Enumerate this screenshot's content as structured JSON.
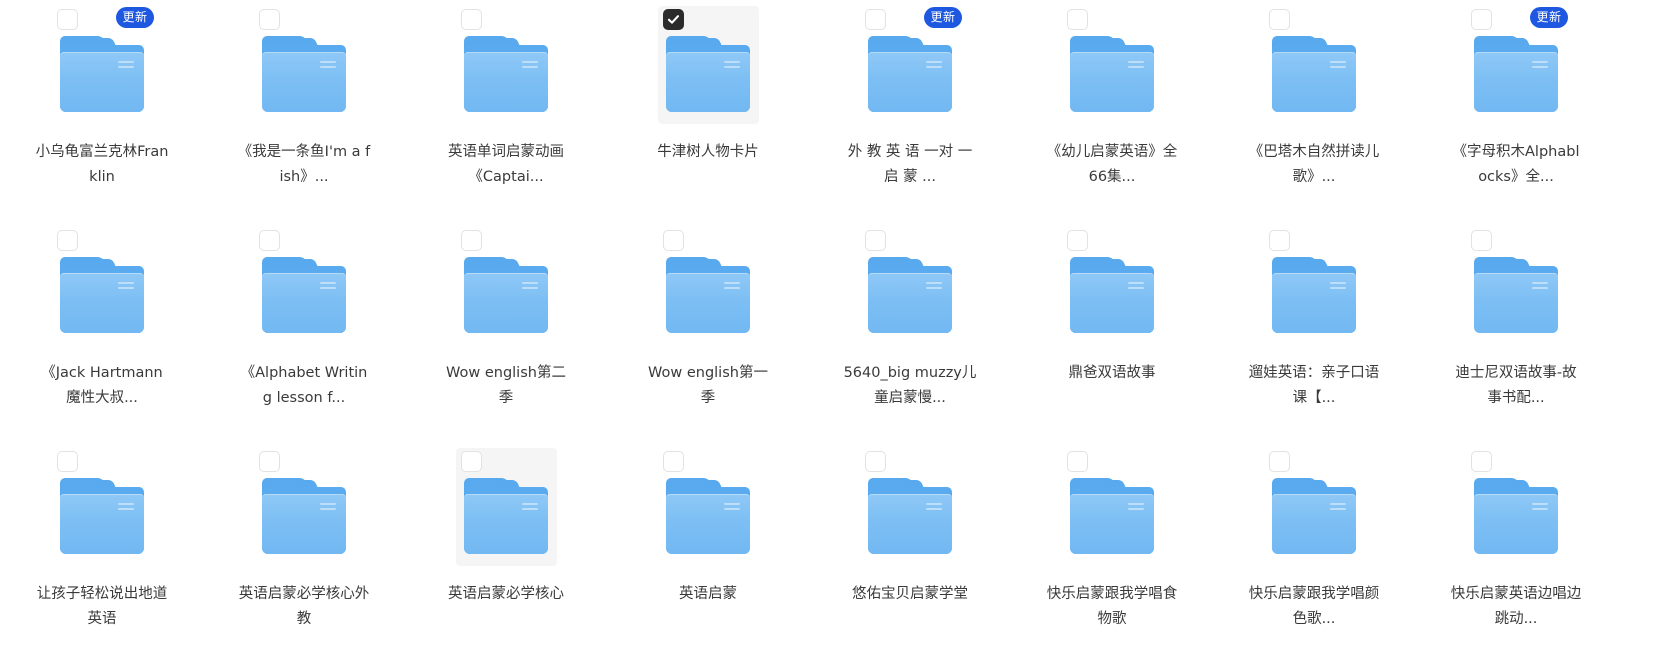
{
  "view": {
    "type": "folder-grid",
    "columns": 8,
    "rows": 3,
    "background_color": "#ffffff",
    "label_color": "#3a3a3a",
    "highlight_color": "#f5f5f5",
    "badge_color": "#1f58e0",
    "folder_color": "#7dbff4",
    "checkbox_checked_color": "#2b2b2b"
  },
  "badge": {
    "label": "更新"
  },
  "items": [
    {
      "name": "小乌龟富兰克林Franklin",
      "badge": true,
      "checked": false,
      "hover": false,
      "icon": "folder-icon"
    },
    {
      "name": "《我是一条鱼I'm a fish》...",
      "badge": false,
      "checked": false,
      "hover": false,
      "icon": "folder-icon"
    },
    {
      "name": "英语单词启蒙动画《Captai...",
      "badge": false,
      "checked": false,
      "hover": false,
      "icon": "folder-icon"
    },
    {
      "name": "牛津树人物卡片",
      "badge": false,
      "checked": true,
      "hover": false,
      "icon": "folder-icon"
    },
    {
      "name": "外 教 英 语 一对 一 启 蒙 ...",
      "badge": true,
      "checked": false,
      "hover": false,
      "icon": "folder-icon"
    },
    {
      "name": "《幼儿启蒙英语》全66集...",
      "badge": false,
      "checked": false,
      "hover": false,
      "icon": "folder-icon"
    },
    {
      "name": "《巴塔木自然拼读儿歌》...",
      "badge": false,
      "checked": false,
      "hover": false,
      "icon": "folder-icon"
    },
    {
      "name": "《字母积木Alphablocks》全...",
      "badge": true,
      "checked": false,
      "hover": false,
      "icon": "folder-icon"
    },
    {
      "name": "《Jack Hartmann 魔性大叔...",
      "badge": false,
      "checked": false,
      "hover": false,
      "icon": "folder-icon"
    },
    {
      "name": "《Alphabet Writing lesson f...",
      "badge": false,
      "checked": false,
      "hover": false,
      "icon": "folder-icon"
    },
    {
      "name": "Wow english第二季",
      "badge": false,
      "checked": false,
      "hover": false,
      "icon": "folder-icon"
    },
    {
      "name": "Wow english第一季",
      "badge": false,
      "checked": false,
      "hover": false,
      "icon": "folder-icon"
    },
    {
      "name": "5640_big muzzy儿童启蒙慢...",
      "badge": false,
      "checked": false,
      "hover": false,
      "icon": "folder-icon"
    },
    {
      "name": "鼎爸双语故事",
      "badge": false,
      "checked": false,
      "hover": false,
      "icon": "folder-icon"
    },
    {
      "name": "遛娃英语：亲子口语课【...",
      "badge": false,
      "checked": false,
      "hover": false,
      "icon": "folder-icon"
    },
    {
      "name": "迪士尼双语故事-故事书配...",
      "badge": false,
      "checked": false,
      "hover": false,
      "icon": "folder-icon"
    },
    {
      "name": "让孩子轻松说出地道英语",
      "badge": false,
      "checked": false,
      "hover": false,
      "icon": "folder-icon"
    },
    {
      "name": "英语启蒙必学核心外教",
      "badge": false,
      "checked": false,
      "hover": false,
      "icon": "folder-icon"
    },
    {
      "name": "英语启蒙必学核心",
      "badge": false,
      "checked": false,
      "hover": true,
      "icon": "folder-icon"
    },
    {
      "name": "英语启蒙",
      "badge": false,
      "checked": false,
      "hover": false,
      "icon": "folder-icon"
    },
    {
      "name": "悠佑宝贝启蒙学堂",
      "badge": false,
      "checked": false,
      "hover": false,
      "icon": "folder-icon"
    },
    {
      "name": "快乐启蒙跟我学唱食物歌",
      "badge": false,
      "checked": false,
      "hover": false,
      "icon": "folder-icon"
    },
    {
      "name": "快乐启蒙跟我学唱颜色歌...",
      "badge": false,
      "checked": false,
      "hover": false,
      "icon": "folder-icon"
    },
    {
      "name": "快乐启蒙英语边唱边跳动...",
      "badge": false,
      "checked": false,
      "hover": false,
      "icon": "folder-icon"
    }
  ]
}
